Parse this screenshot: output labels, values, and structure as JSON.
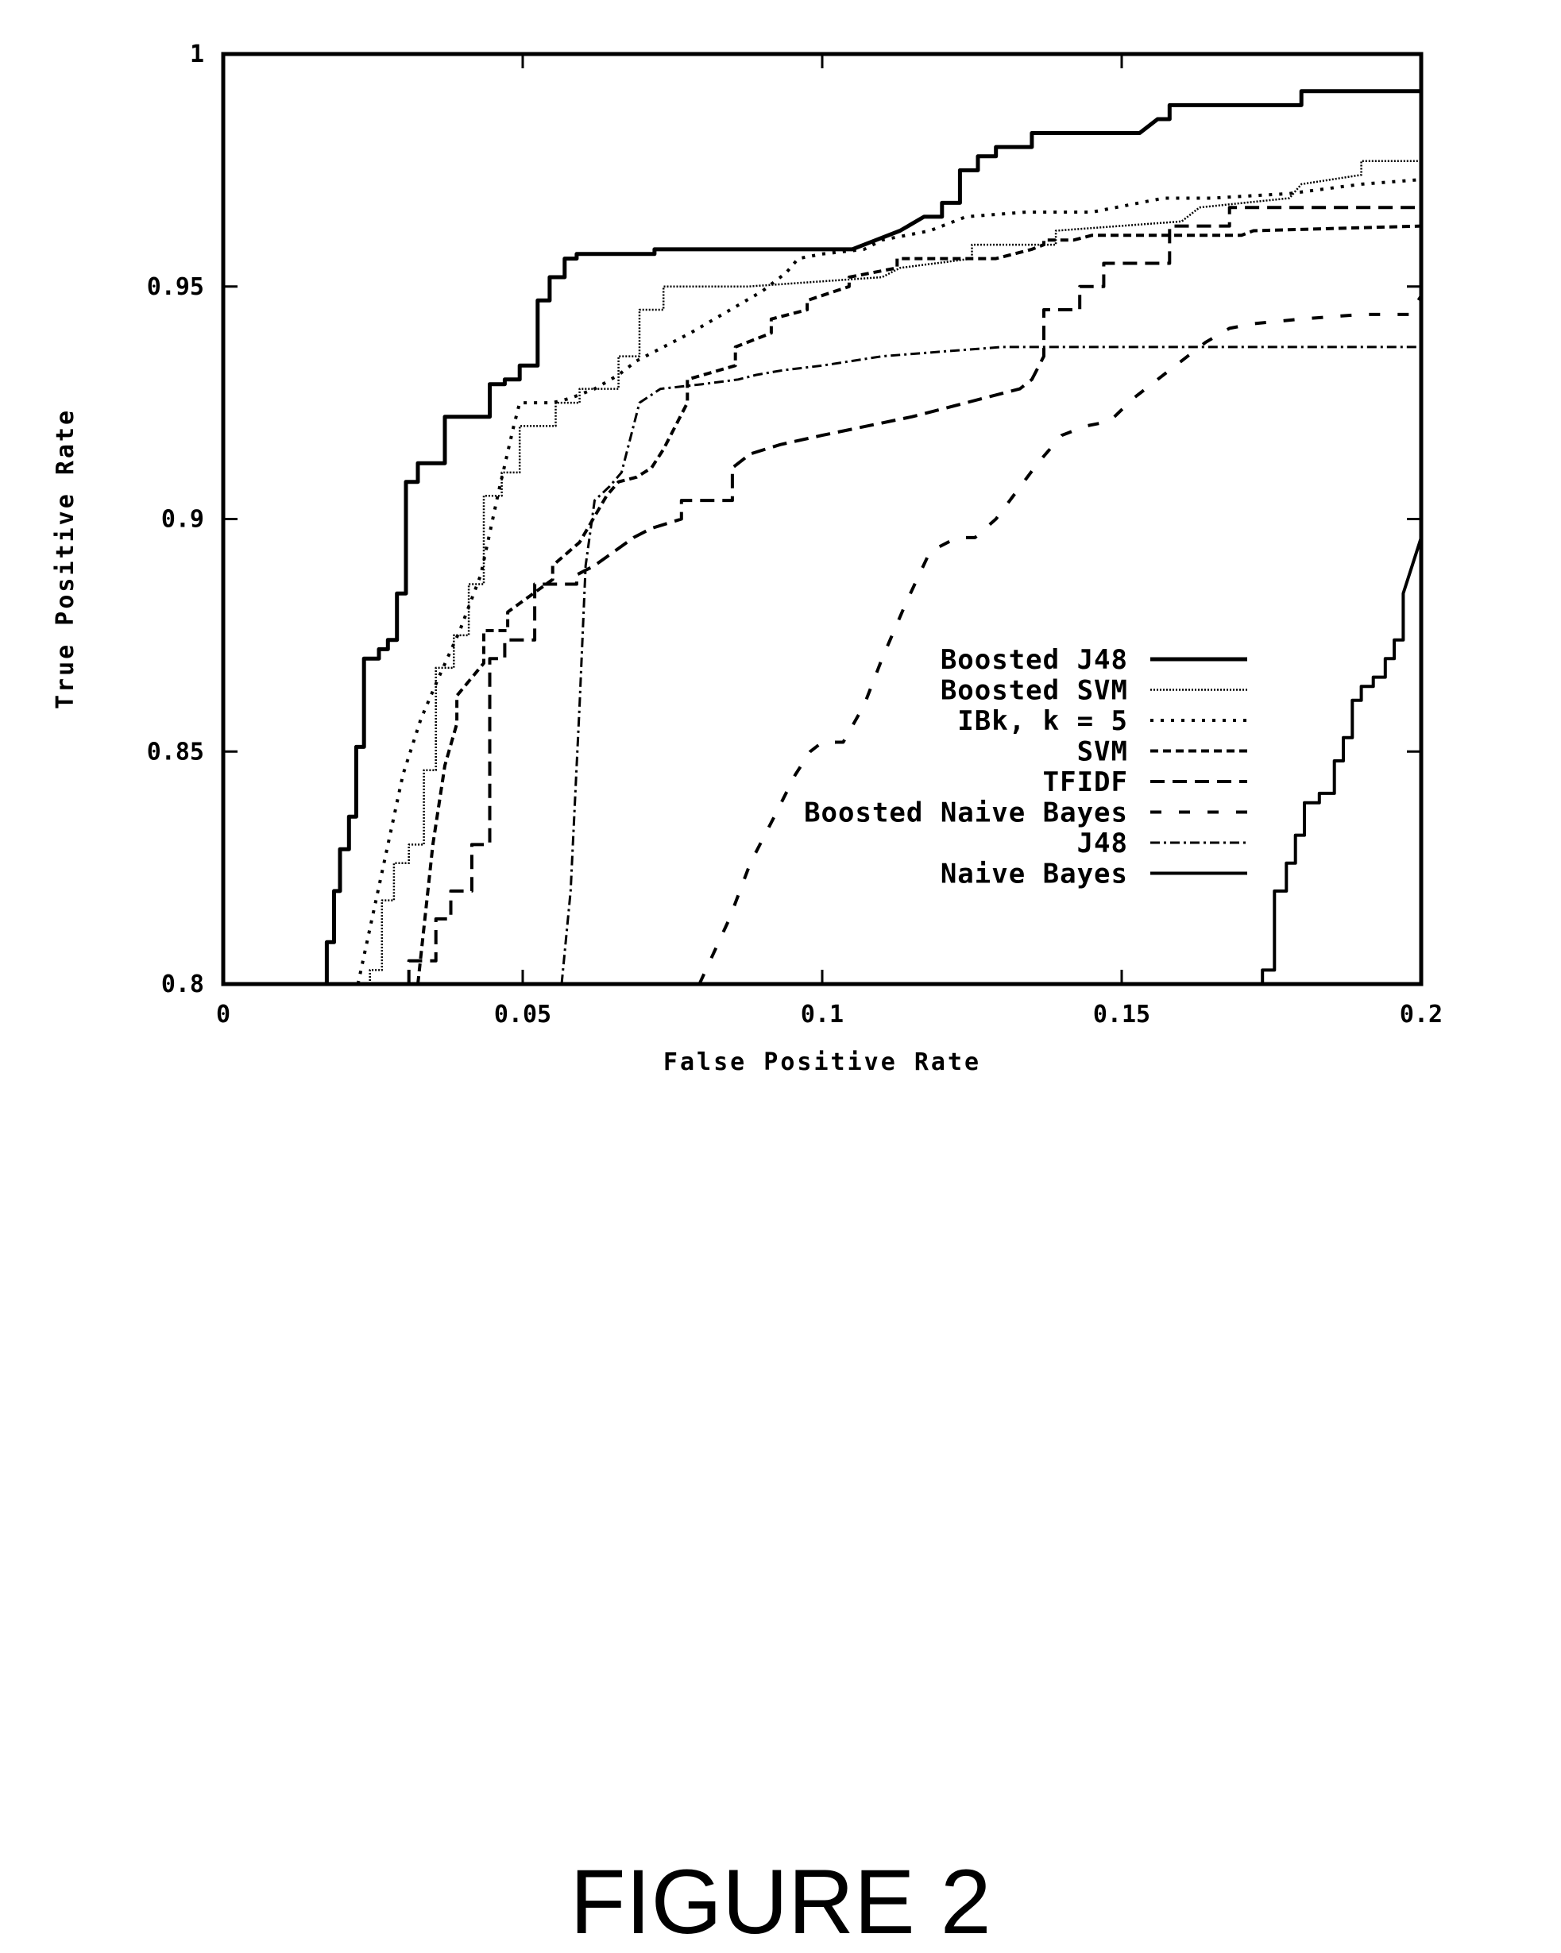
{
  "figure_caption": "FIGURE 2",
  "chart_data": {
    "type": "line",
    "title": "",
    "xlabel": "False Positive Rate",
    "ylabel": "True Positive Rate",
    "xlim": [
      0,
      0.2
    ],
    "ylim": [
      0.8,
      1
    ],
    "xticks": [
      0,
      0.05,
      0.1,
      0.15,
      0.2
    ],
    "xtick_labels": [
      "0",
      "0.05",
      "0.1",
      "0.15",
      "0.2"
    ],
    "yticks": [
      0.8,
      0.85,
      0.9,
      0.95,
      1
    ],
    "ytick_labels": [
      "0.8",
      "0.85",
      "0.9",
      "0.95",
      "1"
    ],
    "grid": false,
    "legend_position": "center-right",
    "series": [
      {
        "name": "Boosted J48",
        "style": "solid-thick",
        "x": [
          0.0173,
          0.0173,
          0.0185,
          0.0185,
          0.0195,
          0.0195,
          0.021,
          0.021,
          0.0222,
          0.0222,
          0.0235,
          0.0235,
          0.026,
          0.026,
          0.0275,
          0.0275,
          0.029,
          0.029,
          0.0305,
          0.0305,
          0.0325,
          0.0325,
          0.0345,
          0.0345,
          0.037,
          0.037,
          0.0445,
          0.0445,
          0.047,
          0.047,
          0.0495,
          0.0495,
          0.0525,
          0.0525,
          0.0545,
          0.0545,
          0.057,
          0.057,
          0.059,
          0.059,
          0.072,
          0.072,
          0.105,
          0.109,
          0.113,
          0.117,
          0.12,
          0.12,
          0.123,
          0.123,
          0.126,
          0.126,
          0.129,
          0.129,
          0.135,
          0.135,
          0.153,
          0.156,
          0.158,
          0.158,
          0.18,
          0.18,
          0.2
        ],
        "y": [
          0.8,
          0.809,
          0.809,
          0.82,
          0.82,
          0.829,
          0.829,
          0.836,
          0.836,
          0.851,
          0.851,
          0.87,
          0.87,
          0.872,
          0.872,
          0.874,
          0.874,
          0.884,
          0.884,
          0.908,
          0.908,
          0.912,
          0.912,
          0.912,
          0.912,
          0.922,
          0.922,
          0.929,
          0.929,
          0.93,
          0.93,
          0.933,
          0.933,
          0.947,
          0.947,
          0.952,
          0.952,
          0.956,
          0.956,
          0.957,
          0.957,
          0.958,
          0.958,
          0.96,
          0.962,
          0.965,
          0.965,
          0.968,
          0.968,
          0.975,
          0.975,
          0.978,
          0.978,
          0.98,
          0.98,
          0.983,
          0.983,
          0.986,
          0.986,
          0.989,
          0.989,
          0.992,
          0.992
        ]
      },
      {
        "name": "Boosted SVM",
        "style": "fine-dotted",
        "x": [
          0.0245,
          0.0245,
          0.0265,
          0.0265,
          0.0285,
          0.0285,
          0.031,
          0.031,
          0.0335,
          0.0335,
          0.0355,
          0.0355,
          0.0385,
          0.0385,
          0.041,
          0.041,
          0.0435,
          0.0435,
          0.0465,
          0.0465,
          0.0495,
          0.0495,
          0.0555,
          0.0555,
          0.0595,
          0.0595,
          0.066,
          0.066,
          0.0695,
          0.0695,
          0.0735,
          0.0735,
          0.0875,
          0.0875,
          0.11,
          0.113,
          0.125,
          0.125,
          0.139,
          0.139,
          0.16,
          0.163,
          0.178,
          0.18,
          0.19,
          0.19,
          0.2
        ],
        "y": [
          0.8,
          0.803,
          0.803,
          0.818,
          0.818,
          0.826,
          0.826,
          0.83,
          0.83,
          0.846,
          0.846,
          0.868,
          0.868,
          0.875,
          0.875,
          0.886,
          0.886,
          0.905,
          0.905,
          0.91,
          0.91,
          0.92,
          0.92,
          0.925,
          0.925,
          0.928,
          0.928,
          0.935,
          0.935,
          0.945,
          0.945,
          0.95,
          0.95,
          0.95,
          0.952,
          0.954,
          0.956,
          0.959,
          0.959,
          0.962,
          0.964,
          0.967,
          0.969,
          0.972,
          0.974,
          0.977,
          0.977
        ]
      },
      {
        "name": "IBk, k = 5",
        "style": "dotted",
        "x": [
          0.0225,
          0.027,
          0.03,
          0.033,
          0.036,
          0.0395,
          0.043,
          0.046,
          0.0485,
          0.0495,
          0.0495,
          0.055,
          0.058,
          0.062,
          0.066,
          0.069,
          0.072,
          0.075,
          0.078,
          0.082,
          0.086,
          0.09,
          0.094,
          0.096,
          0.1,
          0.107,
          0.11,
          0.118,
          0.124,
          0.134,
          0.139,
          0.145,
          0.157,
          0.165,
          0.178,
          0.19,
          0.2
        ],
        "y": [
          0.8,
          0.827,
          0.845,
          0.857,
          0.866,
          0.876,
          0.888,
          0.906,
          0.92,
          0.925,
          0.925,
          0.925,
          0.926,
          0.928,
          0.931,
          0.934,
          0.936,
          0.938,
          0.94,
          0.943,
          0.946,
          0.949,
          0.953,
          0.956,
          0.957,
          0.958,
          0.96,
          0.962,
          0.965,
          0.966,
          0.966,
          0.966,
          0.969,
          0.969,
          0.97,
          0.972,
          0.973
        ]
      },
      {
        "name": "SVM",
        "style": "short-dash",
        "x": [
          0.0325,
          0.035,
          0.037,
          0.039,
          0.039,
          0.0435,
          0.0435,
          0.0475,
          0.0475,
          0.055,
          0.055,
          0.0595,
          0.064,
          0.066,
          0.069,
          0.0715,
          0.0735,
          0.0775,
          0.0775,
          0.0855,
          0.0855,
          0.0915,
          0.0915,
          0.0975,
          0.0975,
          0.1045,
          0.1045,
          0.1125,
          0.1125,
          0.129,
          0.135,
          0.137,
          0.137,
          0.142,
          0.145,
          0.148,
          0.17,
          0.172,
          0.2
        ],
        "y": [
          0.8,
          0.83,
          0.847,
          0.856,
          0.862,
          0.869,
          0.876,
          0.876,
          0.88,
          0.887,
          0.89,
          0.895,
          0.905,
          0.908,
          0.909,
          0.911,
          0.915,
          0.925,
          0.93,
          0.933,
          0.937,
          0.94,
          0.943,
          0.945,
          0.947,
          0.95,
          0.952,
          0.954,
          0.956,
          0.956,
          0.958,
          0.959,
          0.96,
          0.96,
          0.961,
          0.961,
          0.961,
          0.962,
          0.963
        ]
      },
      {
        "name": "TFIDF",
        "style": "dashed",
        "x": [
          0.031,
          0.031,
          0.0355,
          0.0355,
          0.038,
          0.038,
          0.0415,
          0.0415,
          0.0445,
          0.0445,
          0.047,
          0.047,
          0.052,
          0.052,
          0.059,
          0.059,
          0.062,
          0.0685,
          0.0715,
          0.0765,
          0.0765,
          0.085,
          0.085,
          0.088,
          0.093,
          0.1,
          0.115,
          0.127,
          0.133,
          0.135,
          0.137,
          0.137,
          0.143,
          0.143,
          0.147,
          0.147,
          0.158,
          0.158,
          0.168,
          0.168,
          0.2
        ],
        "y": [
          0.8,
          0.805,
          0.805,
          0.814,
          0.814,
          0.82,
          0.82,
          0.83,
          0.83,
          0.87,
          0.87,
          0.874,
          0.874,
          0.886,
          0.886,
          0.888,
          0.89,
          0.896,
          0.898,
          0.9,
          0.904,
          0.904,
          0.911,
          0.914,
          0.916,
          0.918,
          0.922,
          0.926,
          0.928,
          0.93,
          0.935,
          0.945,
          0.945,
          0.95,
          0.95,
          0.955,
          0.955,
          0.963,
          0.963,
          0.967,
          0.967
        ]
      },
      {
        "name": "Boosted Naive Bayes",
        "style": "long-dash",
        "x": [
          0.0795,
          0.0845,
          0.088,
          0.092,
          0.0955,
          0.098,
          0.1,
          0.1035,
          0.107,
          0.11,
          0.114,
          0.118,
          0.1225,
          0.1255,
          0.129,
          0.1325,
          0.136,
          0.14,
          0.144,
          0.148,
          0.152,
          0.156,
          0.16,
          0.164,
          0.168,
          0.172,
          0.18,
          0.19,
          0.198,
          0.2
        ],
        "y": [
          0.8,
          0.814,
          0.826,
          0.836,
          0.845,
          0.85,
          0.852,
          0.852,
          0.86,
          0.87,
          0.882,
          0.893,
          0.896,
          0.896,
          0.9,
          0.906,
          0.912,
          0.918,
          0.92,
          0.921,
          0.926,
          0.93,
          0.934,
          0.938,
          0.941,
          0.942,
          0.943,
          0.944,
          0.944,
          0.948
        ]
      },
      {
        "name": "J48",
        "style": "dash-dot",
        "x": [
          0.0565,
          0.058,
          0.0595,
          0.0605,
          0.062,
          0.0645,
          0.0665,
          0.0695,
          0.073,
          0.08,
          0.086,
          0.089,
          0.0935,
          0.1,
          0.11,
          0.12,
          0.13,
          0.14,
          0.16,
          0.2
        ],
        "y": [
          0.8,
          0.82,
          0.86,
          0.89,
          0.904,
          0.907,
          0.91,
          0.925,
          0.928,
          0.929,
          0.93,
          0.931,
          0.932,
          0.933,
          0.935,
          0.936,
          0.937,
          0.937,
          0.937,
          0.937
        ]
      },
      {
        "name": "Naive Bayes",
        "style": "solid",
        "x": [
          0.1735,
          0.1735,
          0.1755,
          0.1755,
          0.1775,
          0.1775,
          0.179,
          0.179,
          0.1805,
          0.1805,
          0.183,
          0.183,
          0.1855,
          0.1855,
          0.187,
          0.187,
          0.1885,
          0.1885,
          0.19,
          0.19,
          0.192,
          0.192,
          0.194,
          0.194,
          0.1955,
          0.1955,
          0.197,
          0.197,
          0.2
        ],
        "y": [
          0.8,
          0.803,
          0.803,
          0.82,
          0.82,
          0.826,
          0.826,
          0.832,
          0.832,
          0.839,
          0.839,
          0.841,
          0.841,
          0.848,
          0.848,
          0.853,
          0.853,
          0.861,
          0.861,
          0.864,
          0.864,
          0.866,
          0.866,
          0.87,
          0.87,
          0.874,
          0.874,
          0.884,
          0.896
        ]
      }
    ]
  }
}
